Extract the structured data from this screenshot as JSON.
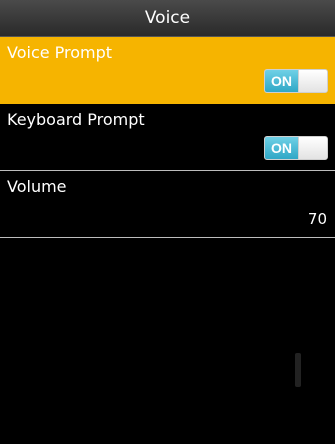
{
  "title": "Voice",
  "items": [
    {
      "label": "Voice Prompt",
      "toggle": "ON",
      "selected": true
    },
    {
      "label": "Keyboard Prompt",
      "toggle": "ON",
      "selected": false
    },
    {
      "label": "Volume",
      "value": "70",
      "selected": false
    }
  ],
  "colors": {
    "selected_bg": "#f6b400",
    "toggle_on": "#2fa7c6",
    "background": "#000000"
  }
}
